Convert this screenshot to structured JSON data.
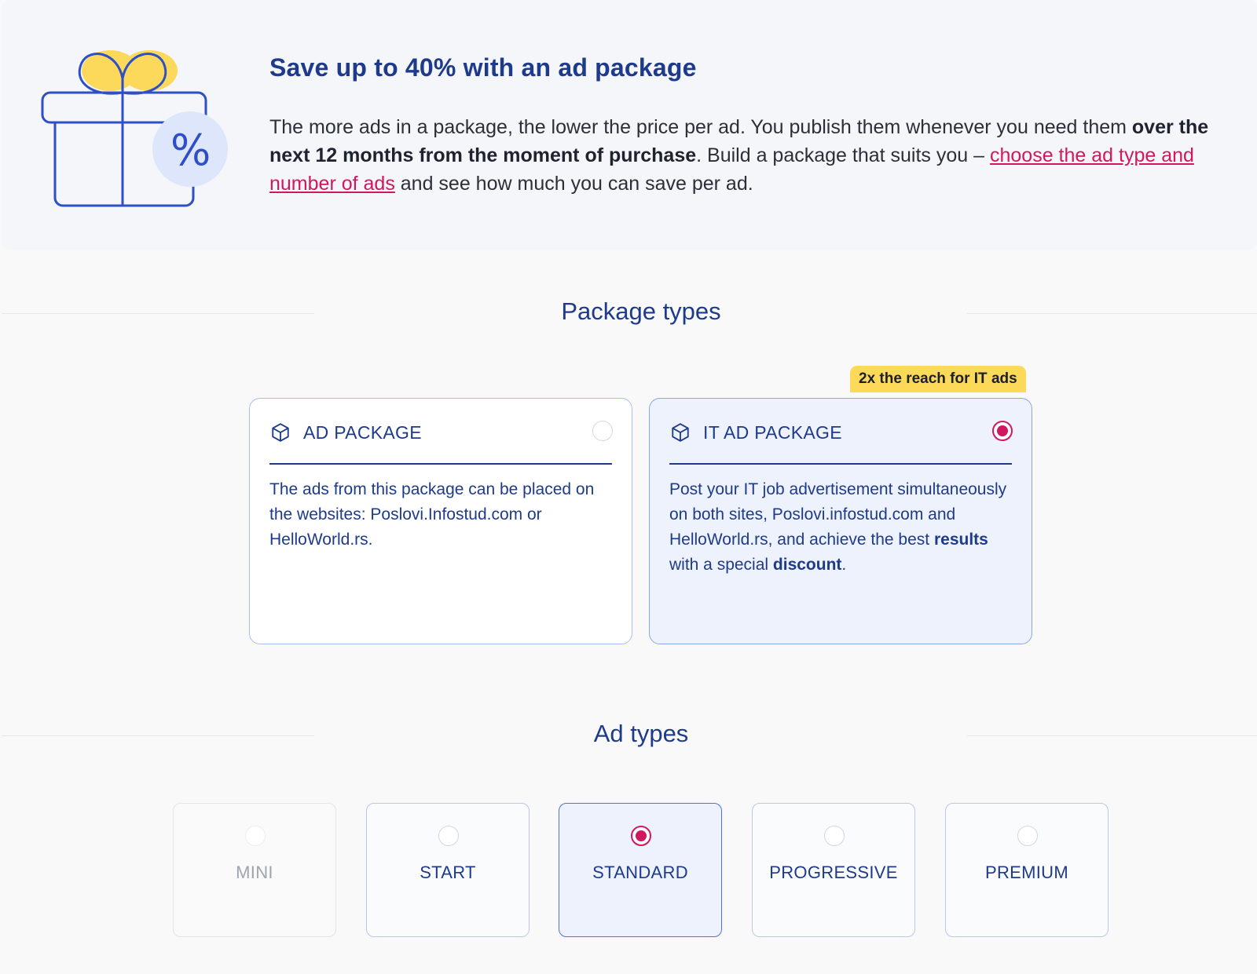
{
  "promo": {
    "title": "Save up to 40% with an ad package",
    "text_1": "The more ads in a package, the lower the price per ad. You publish them whenever you need them ",
    "text_bold": "over the next 12 months from the moment of purchase",
    "text_2": ". Build a package that suits you – ",
    "link": "choose the ad type and number of ads",
    "text_3": " and see how much you can save per ad.",
    "icon": "gift-percent-icon",
    "icon_text": "%"
  },
  "package_section": {
    "title": "Package types",
    "badge": "2x the reach for IT ads",
    "cards": [
      {
        "name": "AD PACKAGE",
        "selected": false,
        "desc": "The ads from this package can be placed on the websites: Poslovi.Infostud.com or HelloWorld.rs."
      },
      {
        "name": "IT AD PACKAGE",
        "selected": true,
        "desc_1": "Post your IT job advertisement simultaneously on both sites, Poslovi.infostud.com and HelloWorld.rs, and achieve the best ",
        "desc_bold_1": "results",
        "desc_2": " with a special ",
        "desc_bold_2": "discount",
        "desc_3": "."
      }
    ]
  },
  "ad_section": {
    "title": "Ad types",
    "types": [
      {
        "label": "MINI",
        "state": "disabled"
      },
      {
        "label": "START",
        "state": "default"
      },
      {
        "label": "STANDARD",
        "state": "selected"
      },
      {
        "label": "PROGRESSIVE",
        "state": "default"
      },
      {
        "label": "PREMIUM",
        "state": "default"
      }
    ]
  },
  "colors": {
    "primary": "#1e3a8a",
    "accent": "#d0175f",
    "badge": "#fdd95a",
    "gift_bow": "#fcd95a",
    "gift_circle": "#dde6fb"
  }
}
